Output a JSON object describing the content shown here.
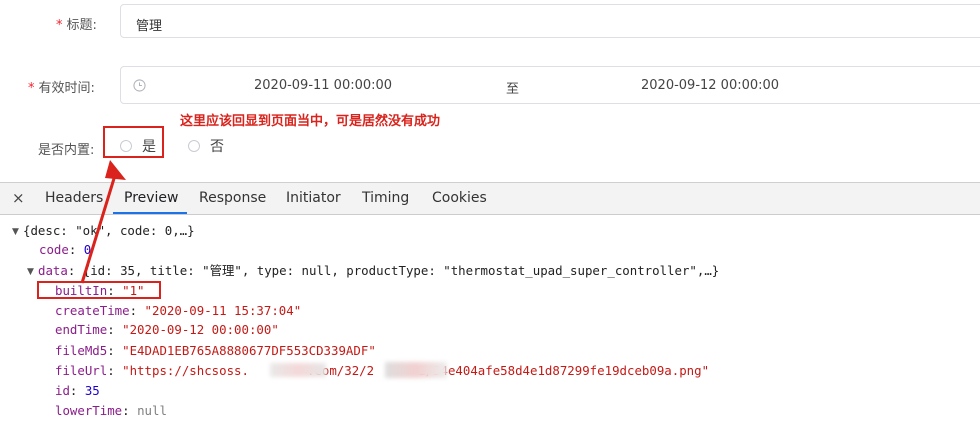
{
  "form": {
    "title_label": "标题:",
    "title_value": "管理",
    "time_label": "有效时间:",
    "start_time": "2020-09-11 00:00:00",
    "range_separator": "至",
    "end_time": "2020-09-12 00:00:00",
    "builtin_label": "是否内置:",
    "radio_yes": "是",
    "radio_no": "否",
    "required_mark": "*",
    "annotation": "这里应该回显到页面当中，可是居然没有成功"
  },
  "devtools": {
    "close": "×",
    "tabs": [
      "Headers",
      "Preview",
      "Response",
      "Initiator",
      "Timing",
      "Cookies"
    ],
    "active_tab": "Preview",
    "tree": {
      "root_summary": "{desc: \"ok\", code: 0,…}",
      "code_key": "code",
      "code_value": "0",
      "data_key": "data",
      "data_summary": "{id: 35, title: \"管理\", type: null, productType: \"thermostat_upad_super_controller\",…}",
      "builtIn_key": "builtIn",
      "builtIn_value": "\"1\"",
      "createTime_key": "createTime",
      "createTime_value": "\"2020-09-11 15:37:04\"",
      "endTime_key": "endTime",
      "endTime_value": "\"2020-09-12 00:00:00\"",
      "fileMd5_key": "fileMd5",
      "fileMd5_value": "\"E4DAD1EB765A8880677DF553CD339ADF\"",
      "fileUrl_key": "fileUrl",
      "fileUrl_part1": "\"https://shcsoss.",
      "fileUrl_part2": ".com/32/2",
      "fileUrl_part3": "1/54e404afe58d4e1d87299fe19dceb09a.png\"",
      "id_key": "id",
      "id_value": "35",
      "lowerTime_key": "lowerTime",
      "lowerTime_value": "null"
    }
  },
  "colors": {
    "annotation_red": "#d9231c",
    "active_tab_blue": "#1a73e8",
    "json_key": "#8a1e8a",
    "json_string": "#c41a16",
    "json_number": "#1c00cf"
  }
}
